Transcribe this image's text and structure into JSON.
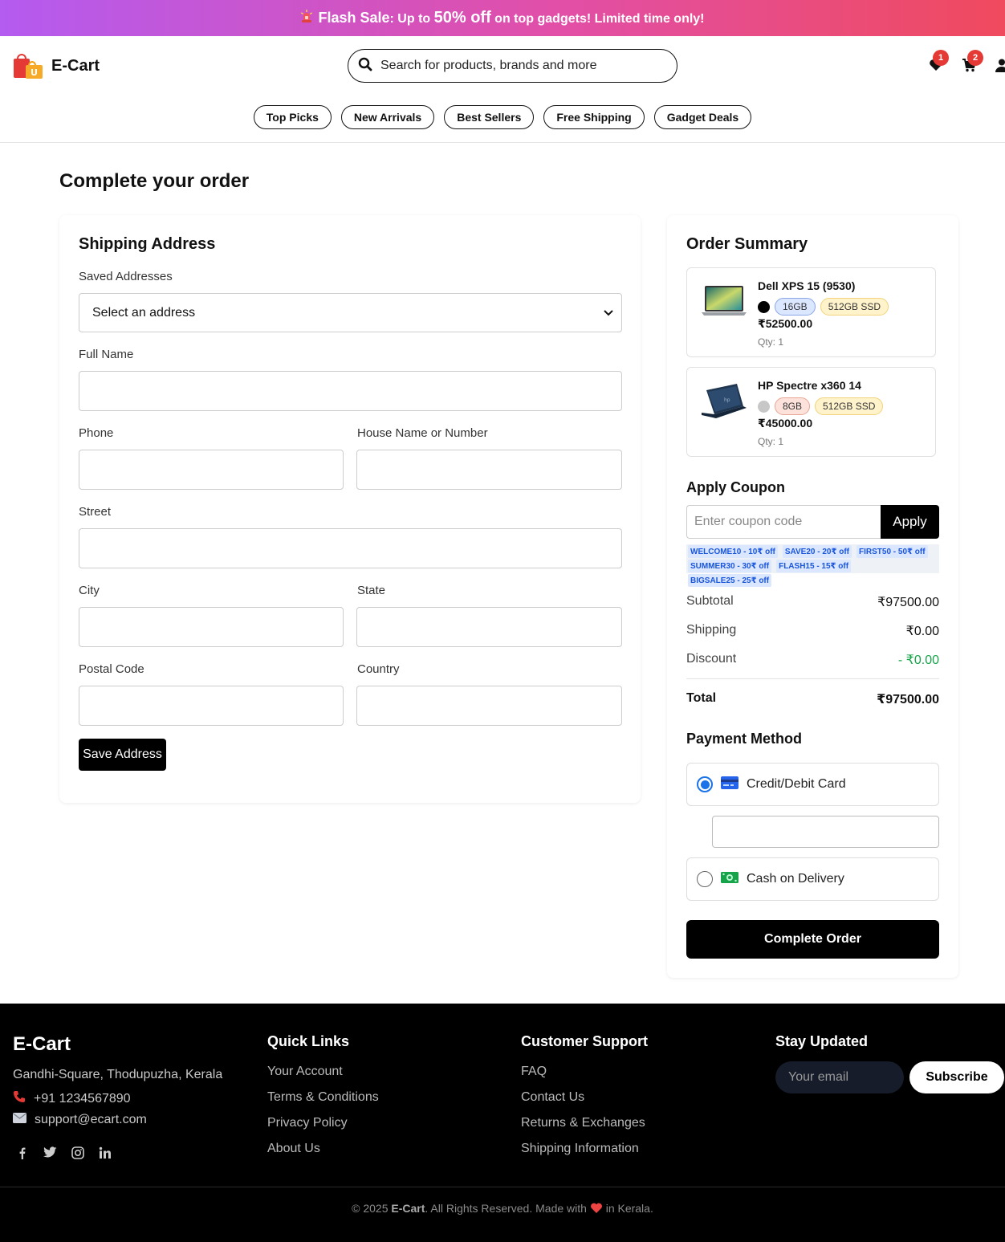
{
  "banner": {
    "icon": "siren-icon",
    "bold": "Flash Sale",
    "text1": ": Up to ",
    "percent": "50% off",
    "text2": " on top gadgets! Limited time only!",
    "gradient": [
      "#b45bf0",
      "#f04a5e"
    ]
  },
  "header": {
    "brand": "E-Cart",
    "search_placeholder": "Search for products, brands and more",
    "wishlist_count": "1",
    "cart_count": "2"
  },
  "pills": [
    "Top Picks",
    "New Arrivals",
    "Best Sellers",
    "Free Shipping",
    "Gadget Deals"
  ],
  "page_title": "Complete your order",
  "shipping": {
    "title": "Shipping Address",
    "saved_label": "Saved Addresses",
    "saved_value": "Select an address",
    "full_name": "Full Name",
    "phone": "Phone",
    "house": "House Name or Number",
    "street": "Street",
    "city": "City",
    "state": "State",
    "postal": "Postal Code",
    "country": "Country",
    "save_button": "Save Address"
  },
  "summary": {
    "title": "Order Summary",
    "items": [
      {
        "name": "Dell XPS 15 (9530)",
        "color": "#000000",
        "ram": "16GB",
        "storage": "512GB SSD",
        "price": "₹52500.00",
        "qty": "Qty: 1"
      },
      {
        "name": "HP Spectre x360 14",
        "color": "#c7c7c7",
        "ram": "8GB",
        "storage": "512GB SSD",
        "price": "₹45000.00",
        "qty": "Qty: 1"
      }
    ],
    "coupon_title": "Apply Coupon",
    "coupon_placeholder": "Enter coupon code",
    "apply": "Apply",
    "codes": [
      "WELCOME10 - 10₹ off",
      "SAVE20 - 20₹ off",
      "FIRST50 - 50₹ off",
      "SUMMER30 - 30₹ off",
      "FLASH15 - 15₹ off",
      "BIGSALE25 - 25₹ off"
    ],
    "subtotal_label": "Subtotal",
    "subtotal": "₹97500.00",
    "shipping_label": "Shipping",
    "shipping": "₹0.00",
    "discount_label": "Discount",
    "discount": "- ₹0.00",
    "total_label": "Total",
    "total": "₹97500.00",
    "payment_title": "Payment Method",
    "card_label": "Credit/Debit Card",
    "cod_label": "Cash on Delivery",
    "complete": "Complete Order"
  },
  "footer": {
    "brand": "E-Cart",
    "address": "Gandhi-Square, Thodupuzha, Kerala",
    "phone": "+91 1234567890",
    "email": "support@ecart.com",
    "quick_title": "Quick Links",
    "quick": [
      "Your Account",
      "Terms & Conditions",
      "Privacy Policy",
      "About Us"
    ],
    "support_title": "Customer Support",
    "support": [
      "FAQ",
      "Contact Us",
      "Returns & Exchanges",
      "Shipping Information"
    ],
    "newsletter_title": "Stay Updated",
    "email_placeholder": "Your email",
    "subscribe": "Subscribe",
    "copy_pre": "© 2025 ",
    "copy_brand": "E-Cart",
    "copy_mid": ". All Rights Reserved. Made with ",
    "copy_post": " in Kerala."
  }
}
